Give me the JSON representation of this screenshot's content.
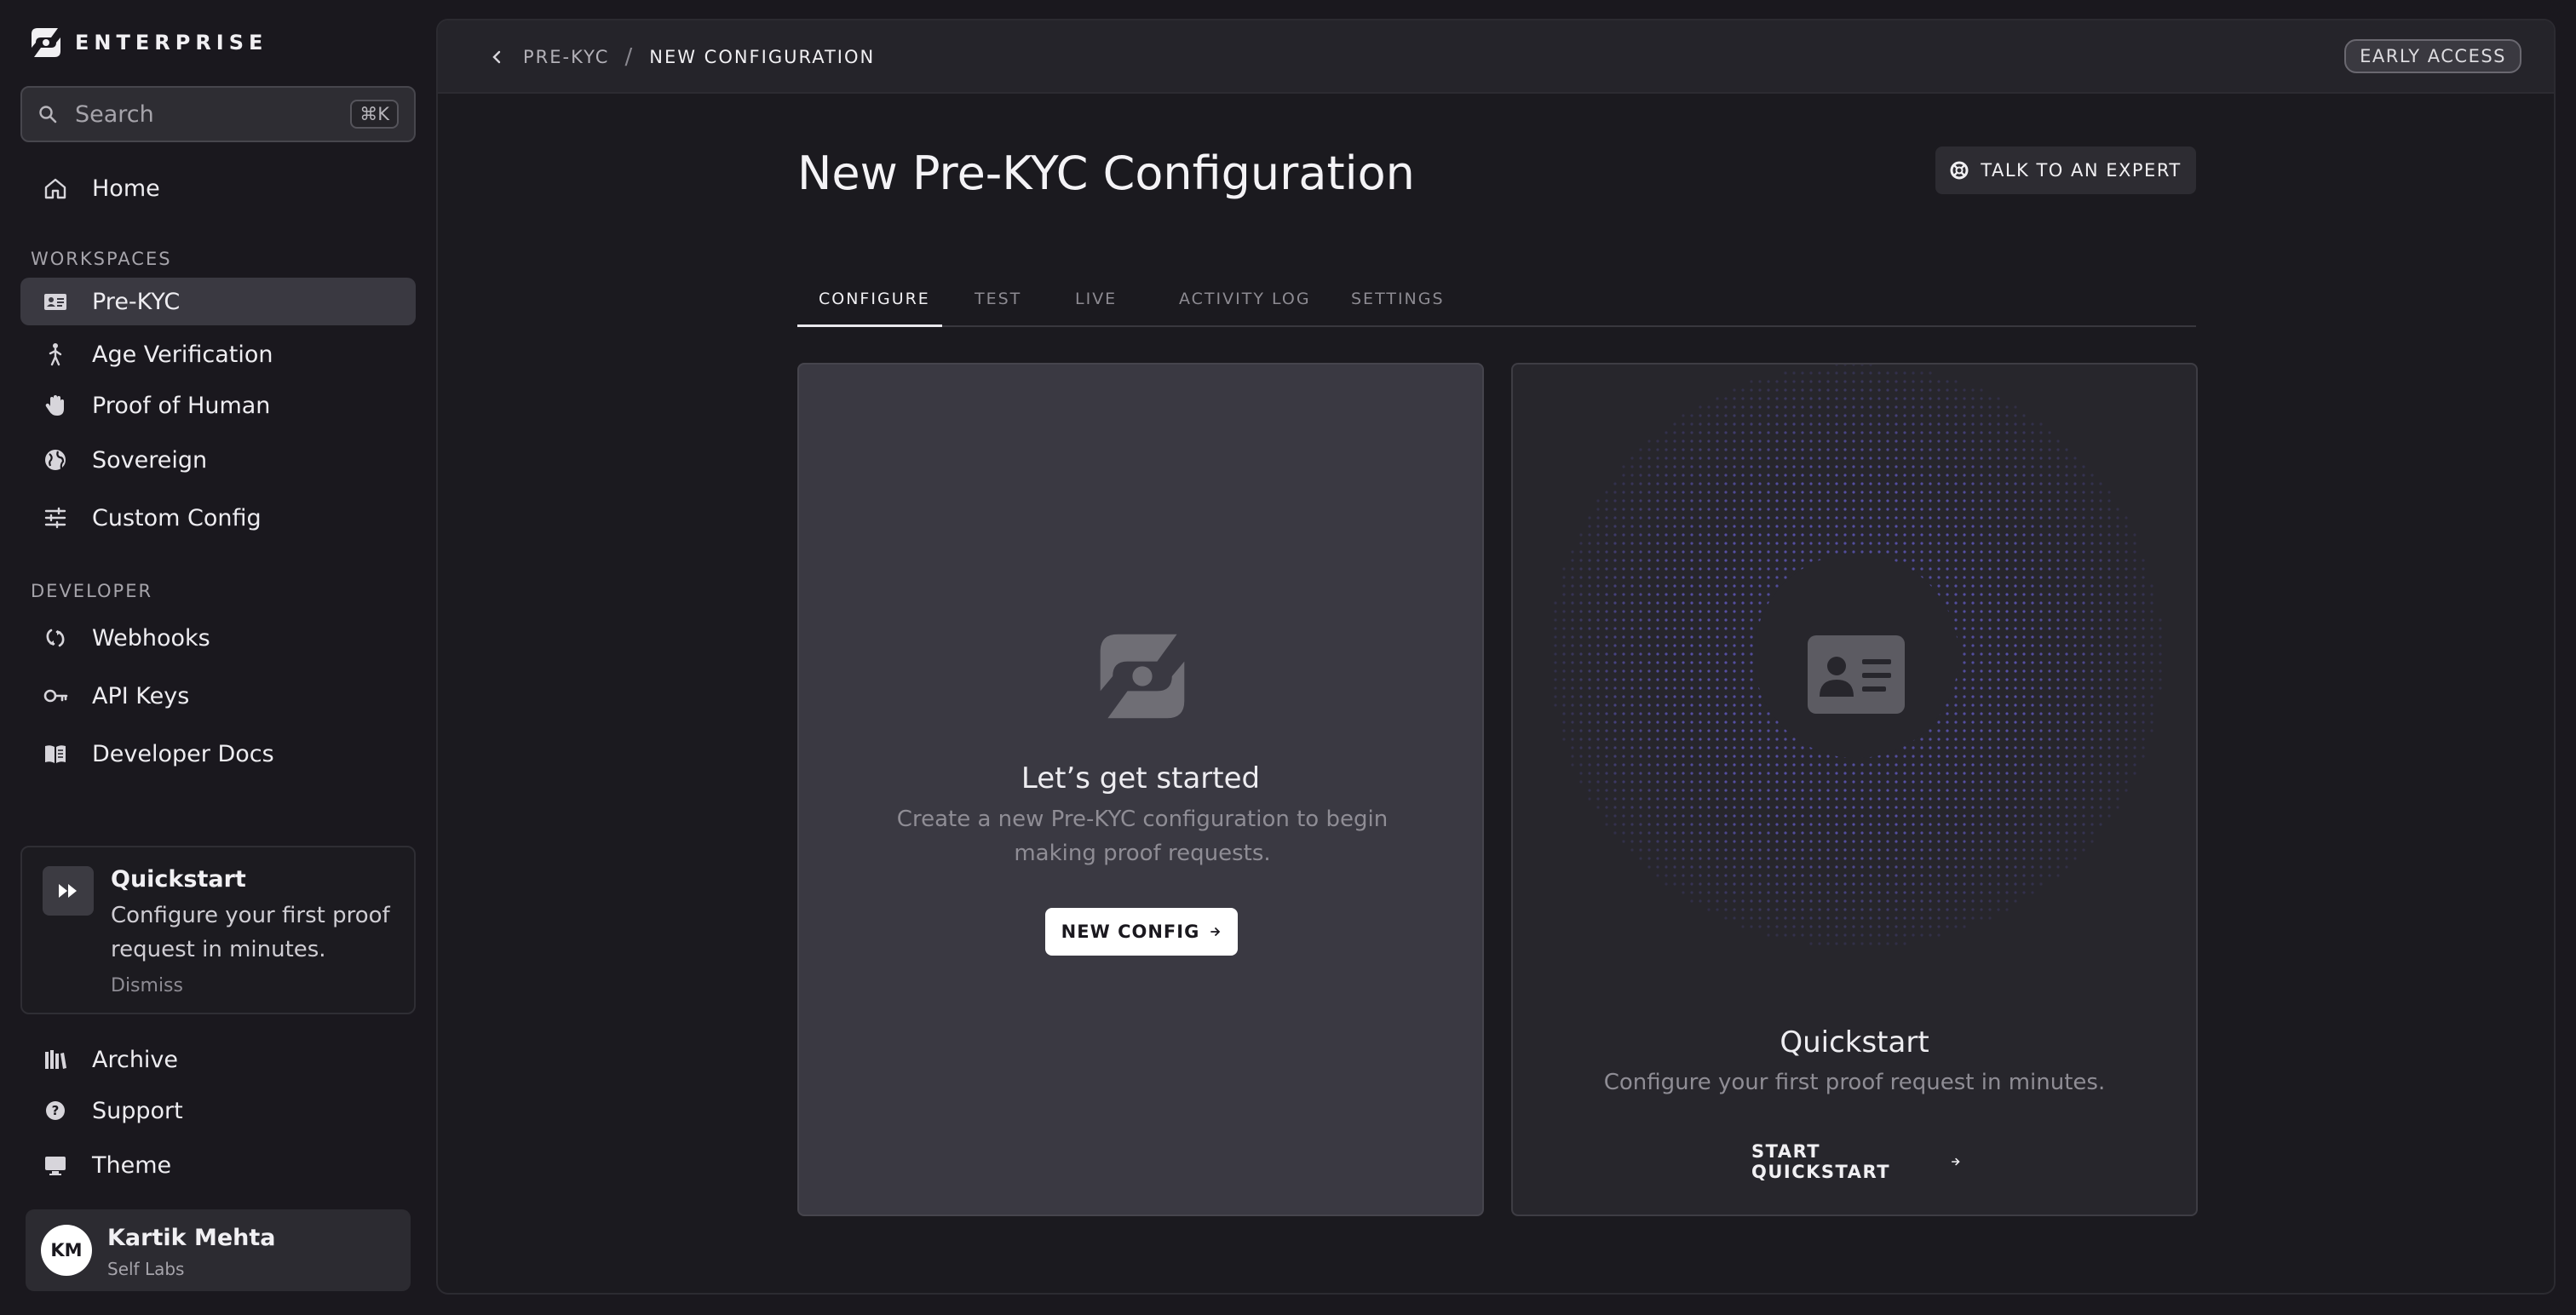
{
  "brand": {
    "name": "ENTERPRISE",
    "logo_icon": "self-logo-icon"
  },
  "search": {
    "placeholder": "Search",
    "shortcut": "⌘K"
  },
  "sidebar": {
    "home_label": "Home",
    "workspaces_heading": "WORKSPACES",
    "workspaces": [
      {
        "label": "Pre-KYC",
        "icon": "id-card-icon",
        "active": true
      },
      {
        "label": "Age Verification",
        "icon": "person-walking-icon"
      },
      {
        "label": "Proof of Human",
        "icon": "hand-icon"
      },
      {
        "label": "Sovereign",
        "icon": "globe-icon"
      },
      {
        "label": "Custom Config",
        "icon": "sliders-icon"
      }
    ],
    "developer_heading": "DEVELOPER",
    "developer": [
      {
        "label": "Webhooks",
        "icon": "webhook-icon"
      },
      {
        "label": "API Keys",
        "icon": "key-icon"
      },
      {
        "label": "Developer Docs",
        "icon": "book-icon"
      }
    ],
    "quickstart": {
      "title": "Quickstart",
      "description": "Configure your first proof request in minutes.",
      "dismiss": "Dismiss"
    },
    "footer": [
      {
        "label": "Archive",
        "icon": "archive-icon"
      },
      {
        "label": "Support",
        "icon": "help-icon"
      },
      {
        "label": "Theme",
        "icon": "monitor-icon"
      }
    ],
    "user": {
      "initials": "KM",
      "name": "Kartik Mehta",
      "org": "Self Labs"
    }
  },
  "topbar": {
    "breadcrumb": [
      "PRE-KYC",
      "NEW CONFIGURATION"
    ],
    "separator": "/",
    "badge": "EARLY ACCESS"
  },
  "page": {
    "title": "New Pre-KYC Configuration",
    "expert_button": "TALK TO AN EXPERT",
    "tabs": [
      "CONFIGURE",
      "TEST",
      "LIVE",
      "ACTIVITY LOG",
      "SETTINGS"
    ],
    "active_tab": "CONFIGURE"
  },
  "empty_state": {
    "title": "Let’s get started",
    "description": "Create a new Pre-KYC configuration to begin making proof requests.",
    "button": "NEW CONFIG"
  },
  "quickstart_card": {
    "title": "Quickstart",
    "description": "Configure your first proof request in minutes.",
    "button": "START QUICKSTART"
  },
  "colors": {
    "background": "#1a181e",
    "panel": "#1b1a1f",
    "active_item": "#3a3941",
    "dot_accent": "#6b62d8"
  }
}
